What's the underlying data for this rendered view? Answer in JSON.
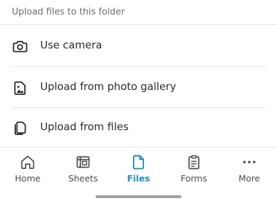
{
  "sheet": {
    "title": "Upload files to this folder",
    "actions": [
      {
        "label": "Use camera",
        "icon": "camera-icon"
      },
      {
        "label": "Upload from photo gallery",
        "icon": "image-icon"
      },
      {
        "label": "Upload from files",
        "icon": "files-icon"
      }
    ]
  },
  "tabbar": {
    "active_color": "#1a8fd1",
    "tabs": [
      {
        "label": "Home",
        "icon": "home-icon",
        "active": false
      },
      {
        "label": "Sheets",
        "icon": "sheets-icon",
        "active": false
      },
      {
        "label": "Files",
        "icon": "file-icon",
        "active": true
      },
      {
        "label": "Forms",
        "icon": "clipboard-icon",
        "active": false
      },
      {
        "label": "More",
        "icon": "more-icon",
        "active": false
      }
    ]
  }
}
